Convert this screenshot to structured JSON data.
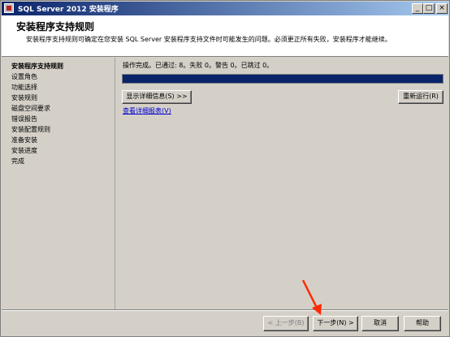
{
  "window": {
    "title": "SQL Server 2012 安装程序",
    "controls": {
      "minimize": "_",
      "maximize": "□",
      "close": "×"
    }
  },
  "header": {
    "title": "安装程序支持规则",
    "description": "安装程序支持规则可确定在您安装 SQL Server 安装程序支持文件时可能发生的问题。必须更正所有失败，安装程序才能继续。"
  },
  "sidebar": {
    "items": [
      {
        "label": "安装程序支持规则",
        "active": true
      },
      {
        "label": "设置角色"
      },
      {
        "label": "功能选择"
      },
      {
        "label": "安装规则"
      },
      {
        "label": "磁盘空间要求"
      },
      {
        "label": "错误报告"
      },
      {
        "label": "安装配置规则"
      },
      {
        "label": "准备安装"
      },
      {
        "label": "安装进度"
      },
      {
        "label": "完成"
      }
    ]
  },
  "main": {
    "status_text": "操作完成。已通过: 8。失败 0。警告 0。已跳过 0。",
    "progress_percent": 100,
    "show_details_label": "显示详细信息(S) >>",
    "rerun_label": "重新运行(R)",
    "view_report_link": "查看详细报表(V)"
  },
  "footer": {
    "prev_label": "< 上一步(B)",
    "next_label": "下一步(N) >",
    "cancel_label": "取消",
    "help_label": "帮助"
  },
  "colors": {
    "title_gradient_start": "#0a246a",
    "progress_fill": "#0a246a",
    "annotation_arrow": "#ff2a00"
  }
}
